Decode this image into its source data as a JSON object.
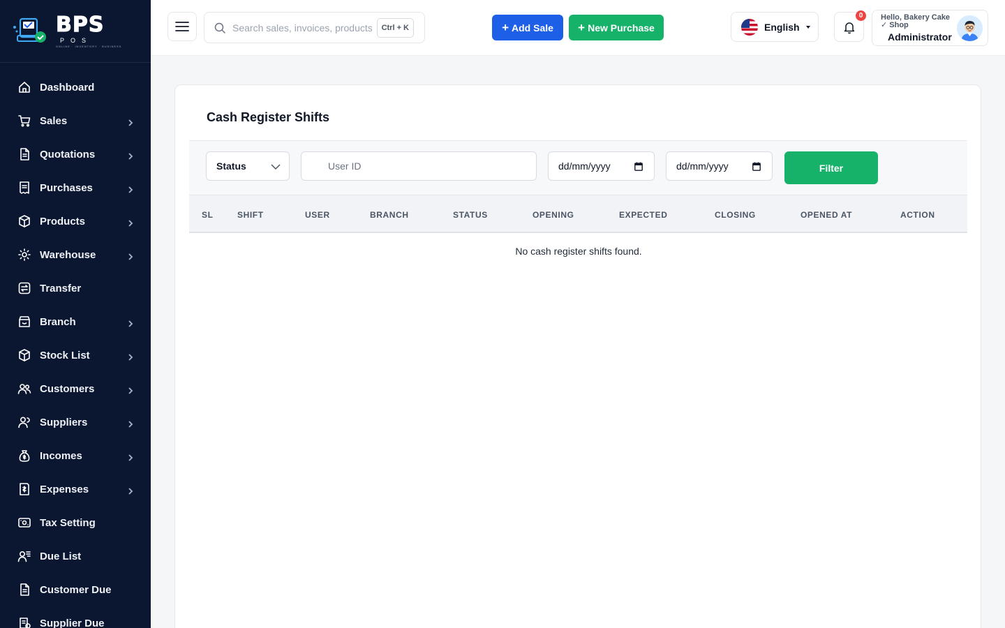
{
  "brand": {
    "name": "BPS",
    "sub": "POS",
    "tagline": "ONLINE · INVENTORY · BUSINESS"
  },
  "sidebar": {
    "items": [
      {
        "label": "Dashboard",
        "icon": "home-icon",
        "has_children": false
      },
      {
        "label": "Sales",
        "icon": "cart-icon",
        "has_children": true
      },
      {
        "label": "Quotations",
        "icon": "document-icon",
        "has_children": true
      },
      {
        "label": "Purchases",
        "icon": "receipt-icon",
        "has_children": true
      },
      {
        "label": "Products",
        "icon": "box-icon",
        "has_children": true
      },
      {
        "label": "Warehouse",
        "icon": "gear-box-icon",
        "has_children": true
      },
      {
        "label": "Transfer",
        "icon": "transfer-icon",
        "has_children": false
      },
      {
        "label": "Branch",
        "icon": "store-icon",
        "has_children": true
      },
      {
        "label": "Stock List",
        "icon": "cube-icon",
        "has_children": true
      },
      {
        "label": "Customers",
        "icon": "users-icon",
        "has_children": true
      },
      {
        "label": "Suppliers",
        "icon": "supplier-icon",
        "has_children": true
      },
      {
        "label": "Incomes",
        "icon": "money-bag-icon",
        "has_children": true
      },
      {
        "label": "Expenses",
        "icon": "expense-icon",
        "has_children": true
      },
      {
        "label": "Tax Setting",
        "icon": "tax-icon",
        "has_children": false
      },
      {
        "label": "Due List",
        "icon": "due-list-icon",
        "has_children": false
      },
      {
        "label": "Customer Due",
        "icon": "customer-due-icon",
        "has_children": false
      },
      {
        "label": "Supplier Due",
        "icon": "supplier-due-icon",
        "has_children": false
      }
    ]
  },
  "header": {
    "search_placeholder": "Search sales, invoices, products...",
    "shortcut": "Ctrl + K",
    "add_sale_label": "Add Sale",
    "new_purchase_label": "New Purchase",
    "language": "English",
    "notification_count": "0",
    "user_greeting": "Hello, Bakery Cake ✓ Shop",
    "user_role": "Administrator"
  },
  "page": {
    "title": "Cash Register Shifts",
    "filters": {
      "status_label": "Status",
      "user_id_placeholder": "User ID",
      "date_from_placeholder": "dd/mm/yyyy",
      "date_to_placeholder": "dd/mm/yyyy",
      "filter_button": "Filter"
    },
    "table": {
      "columns": [
        "SL",
        "SHIFT",
        "USER",
        "BRANCH",
        "STATUS",
        "OPENING",
        "EXPECTED",
        "CLOSING",
        "OPENED AT",
        "ACTION"
      ],
      "rows": [],
      "empty_message": "No cash register shifts found."
    }
  },
  "colors": {
    "sidebar_bg": "#0b1630",
    "primary_blue": "#1d5fe6",
    "primary_green": "#17b26a",
    "badge_red": "#ef4444"
  }
}
